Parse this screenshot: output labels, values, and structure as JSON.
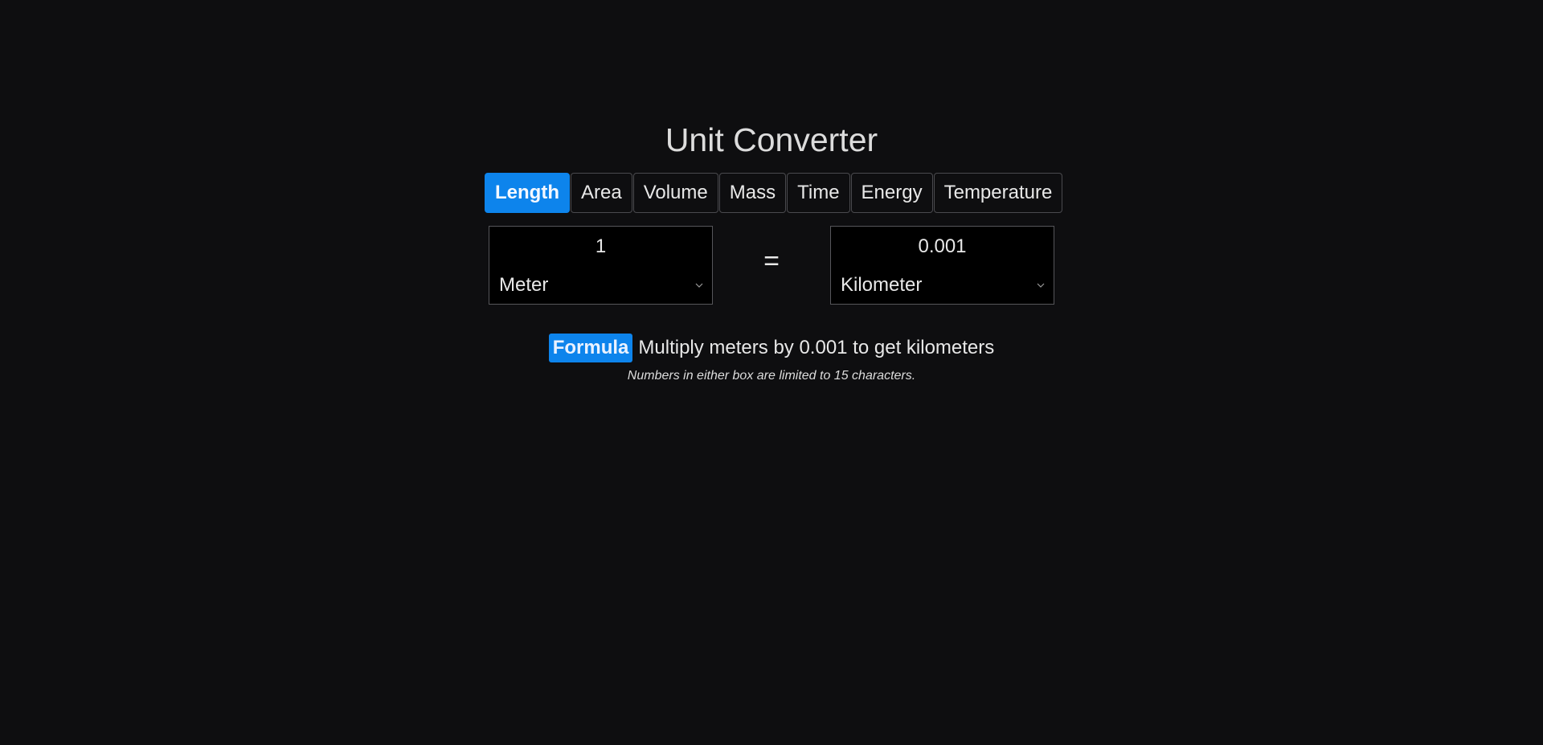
{
  "title": "Unit Converter",
  "tabs": [
    {
      "label": "Length",
      "active": true
    },
    {
      "label": "Area",
      "active": false
    },
    {
      "label": "Volume",
      "active": false
    },
    {
      "label": "Mass",
      "active": false
    },
    {
      "label": "Time",
      "active": false
    },
    {
      "label": "Energy",
      "active": false
    },
    {
      "label": "Temperature",
      "active": false
    }
  ],
  "from": {
    "value": "1",
    "unit": "Meter"
  },
  "equals": "=",
  "to": {
    "value": "0.001",
    "unit": "Kilometer"
  },
  "formula": {
    "badge": "Formula",
    "text": "Multiply meters by 0.001 to get kilometers"
  },
  "note": "Numbers in either box are limited to 15 characters.",
  "colors": {
    "accent": "#0d84ec",
    "background": "#0e0e10",
    "box_background": "#000000"
  },
  "icons": {
    "select_arrow": "chevron-down-icon"
  }
}
